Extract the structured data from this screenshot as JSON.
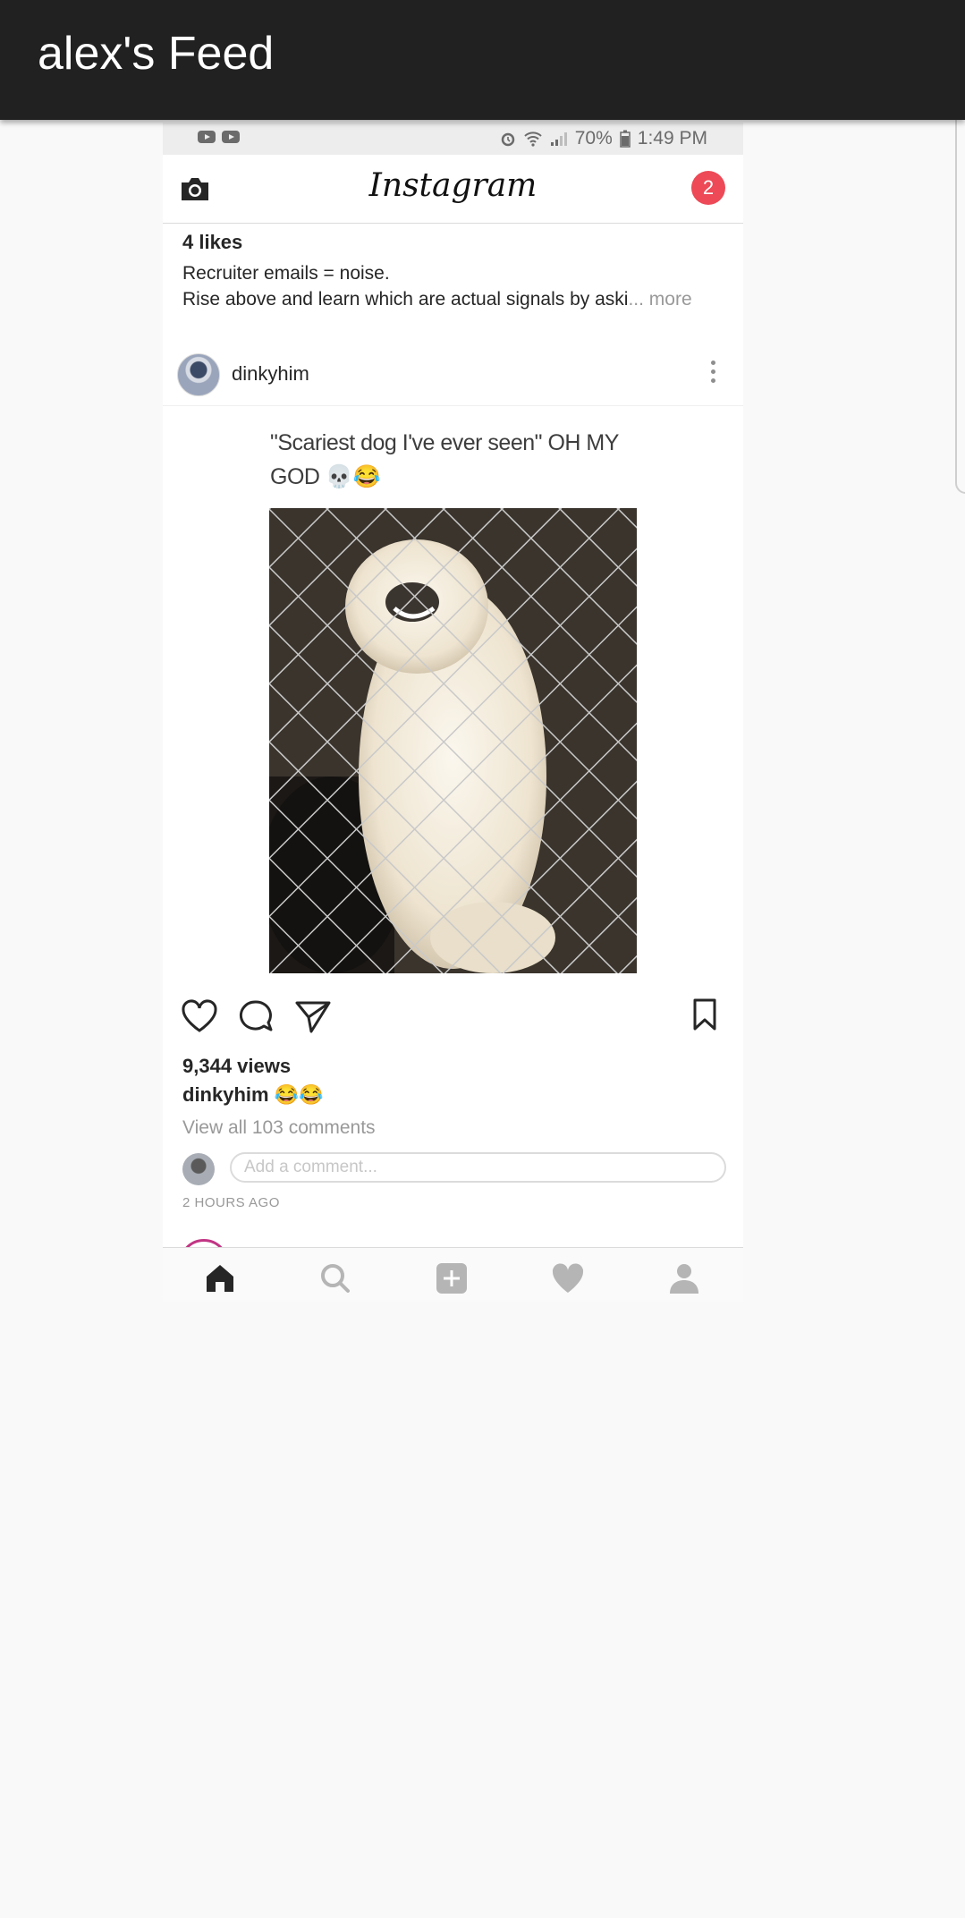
{
  "app_bar": {
    "title": "alex's Feed"
  },
  "status_bar": {
    "battery": "70%",
    "time": "1:49 PM"
  },
  "ig_header": {
    "logo": "Instagram",
    "notification_count": "2"
  },
  "previous_post": {
    "likes": "4 likes",
    "caption_line1": "Recruiter emails = noise.",
    "caption_line2": "Rise above and learn which are actual signals by aski",
    "more_label": "... more"
  },
  "post": {
    "username": "dinkyhim",
    "meme_text": "\"Scariest dog I've ever seen\" OH MY GOD 💀😂",
    "views": "9,344 views",
    "caption_user": "dinkyhim",
    "caption_text": "😂😂",
    "view_comments": "View all 103 comments",
    "comment_placeholder": "Add a comment...",
    "time_ago": "2 HOURS AGO"
  },
  "icons": {
    "camera": "camera-icon",
    "heart": "heart-icon",
    "comment": "comment-icon",
    "share": "share-icon",
    "bookmark": "bookmark-icon",
    "more": "more-vert-icon",
    "home": "home-icon",
    "search": "search-icon",
    "add": "add-icon",
    "activity": "heart-icon",
    "profile": "profile-icon"
  },
  "colors": {
    "app_bar": "#212121",
    "notification": "#ed4956",
    "muted_text": "#999999"
  }
}
